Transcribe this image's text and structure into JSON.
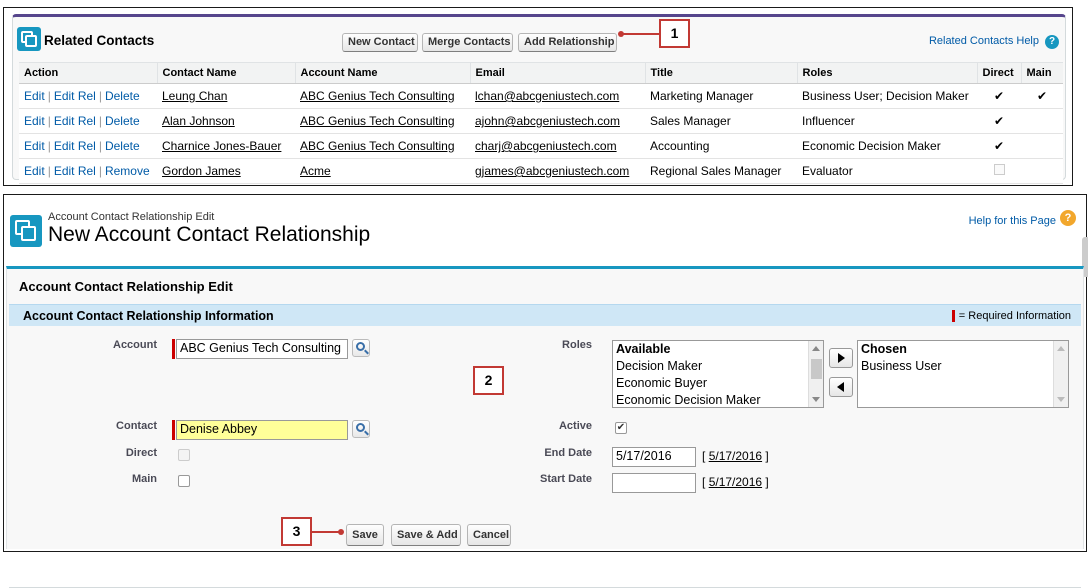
{
  "related_contacts": {
    "title": "Related Contacts",
    "buttons": {
      "new_contact": "New Contact",
      "merge_contacts": "Merge Contacts",
      "add_relationship": "Add Relationship"
    },
    "help_link": "Related Contacts Help",
    "help_icon": "?",
    "columns": [
      "Action",
      "Contact Name",
      "Account Name",
      "Email",
      "Title",
      "Roles",
      "Direct",
      "Main"
    ],
    "rows": [
      {
        "actions": [
          "Edit",
          "Edit Rel",
          "Delete"
        ],
        "contact": "Leung Chan",
        "account": "ABC Genius Tech Consulting",
        "email": "lchan@abcgeniustech.com",
        "title": "Marketing Manager",
        "roles": "Business User; Decision Maker",
        "direct": true,
        "main": true
      },
      {
        "actions": [
          "Edit",
          "Edit Rel",
          "Delete"
        ],
        "contact": "Alan Johnson",
        "account": "ABC Genius Tech Consulting",
        "email": "ajohn@abcgeniustech.com",
        "title": "Sales Manager",
        "roles": "Influencer",
        "direct": true,
        "main": false
      },
      {
        "actions": [
          "Edit",
          "Edit Rel",
          "Delete"
        ],
        "contact": "Charnice Jones-Bauer",
        "account": "ABC Genius Tech Consulting",
        "email": "charj@abcgeniustech.com",
        "title": "Accounting",
        "roles": "Economic Decision Maker",
        "direct": true,
        "main": false
      },
      {
        "actions": [
          "Edit",
          "Edit Rel",
          "Remove"
        ],
        "contact": "Gordon James",
        "account": "Acme",
        "email": "gjames@abcgeniustech.com",
        "title": "Regional Sales Manager",
        "roles": "Evaluator",
        "direct": false,
        "main": false
      }
    ],
    "separator": "|",
    "check_glyph": "✔"
  },
  "callouts": {
    "one": "1",
    "two": "2",
    "three": "3"
  },
  "edit_page": {
    "breadcrumb": "Account Contact Relationship Edit",
    "title": "New Account Contact Relationship",
    "help_link": "Help for this Page",
    "help_icon": "?",
    "block_title": "Account Contact Relationship Edit",
    "section_title": "Account Contact Relationship Information",
    "required_note": "= Required Information",
    "fields": {
      "account_label": "Account",
      "account_value": "ABC Genius Tech Consulting",
      "contact_label": "Contact",
      "contact_value": "Denise Abbey",
      "direct_label": "Direct",
      "main_label": "Main",
      "roles_label": "Roles",
      "active_label": "Active",
      "active_checked": true,
      "end_date_label": "End Date",
      "end_date_value": "5/17/2016",
      "end_date_link": "5/17/2016",
      "start_date_label": "Start Date",
      "start_date_value": "",
      "start_date_link": "5/17/2016",
      "bracket_open": "[",
      "bracket_close": "]"
    },
    "roles_available": {
      "header": "Available",
      "items": [
        "Decision Maker",
        "Economic Buyer",
        "Economic Decision Maker"
      ]
    },
    "roles_chosen": {
      "header": "Chosen",
      "items": [
        "Business User"
      ]
    },
    "buttons": {
      "save": "Save",
      "save_add": "Save & Add",
      "cancel": "Cancel"
    }
  },
  "colors": {
    "accent_blue": "#1797c0",
    "callout_red": "#c23934",
    "link": "#015ba7",
    "section_bg": "#cfe7f6",
    "lookup_bg": "#ffff99"
  }
}
